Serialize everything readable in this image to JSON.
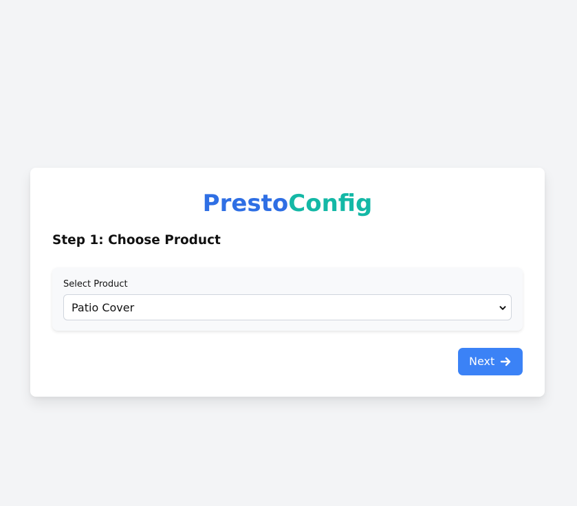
{
  "app": {
    "brand_part1": "Presto",
    "brand_part2": "Config"
  },
  "step": {
    "title": "Step 1: Choose Product"
  },
  "product_select": {
    "label": "Select Product",
    "selected_value": "Patio Cover",
    "chevron_icon": "chevron-down-icon"
  },
  "actions": {
    "next_label": "Next",
    "next_icon": "arrow-right-icon"
  },
  "colors": {
    "page_background": "#f3f4f6",
    "brand_blue": "#2f6fe4",
    "brand_teal": "#14b8a6",
    "primary_button": "#3b82f6"
  }
}
